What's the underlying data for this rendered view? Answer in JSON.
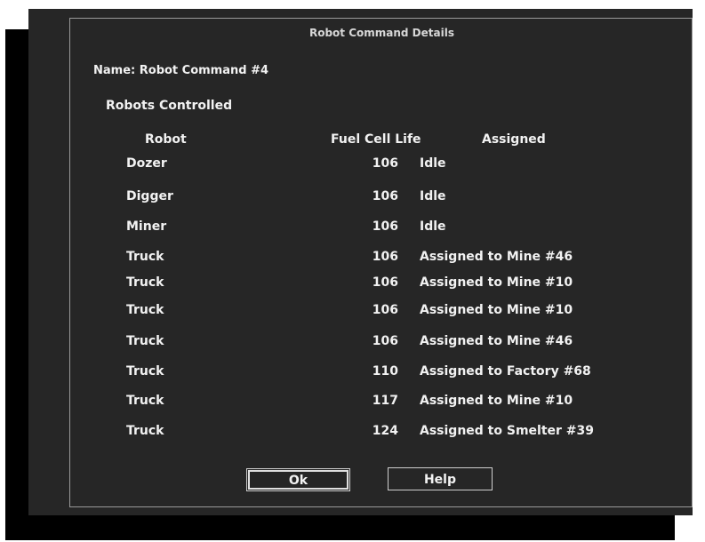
{
  "dialog": {
    "title": "Robot Command Details",
    "name_label": "Name:",
    "name_value": "Robot Command #4",
    "robots_controlled_label": "Robots Controlled",
    "columns": {
      "robot": "Robot",
      "fuel": "Fuel Cell Life",
      "assigned": "Assigned"
    },
    "rows": [
      {
        "robot": "Dozer",
        "fuel": "106",
        "assigned": "Idle"
      },
      {
        "robot": "Digger",
        "fuel": "106",
        "assigned": "Idle"
      },
      {
        "robot": "Miner",
        "fuel": "106",
        "assigned": "Idle"
      },
      {
        "robot": "Truck",
        "fuel": "106",
        "assigned": "Assigned to Mine #46"
      },
      {
        "robot": "Truck",
        "fuel": "106",
        "assigned": "Assigned to Mine #10"
      },
      {
        "robot": "Truck",
        "fuel": "106",
        "assigned": "Assigned to Mine #10"
      },
      {
        "robot": "Truck",
        "fuel": "106",
        "assigned": "Assigned to Mine #46"
      },
      {
        "robot": "Truck",
        "fuel": "110",
        "assigned": "Assigned to Factory #68"
      },
      {
        "robot": "Truck",
        "fuel": "117",
        "assigned": "Assigned to Mine #10"
      },
      {
        "robot": "Truck",
        "fuel": "124",
        "assigned": "Assigned to Smelter #39"
      }
    ],
    "buttons": {
      "ok": "Ok",
      "help": "Help"
    }
  }
}
